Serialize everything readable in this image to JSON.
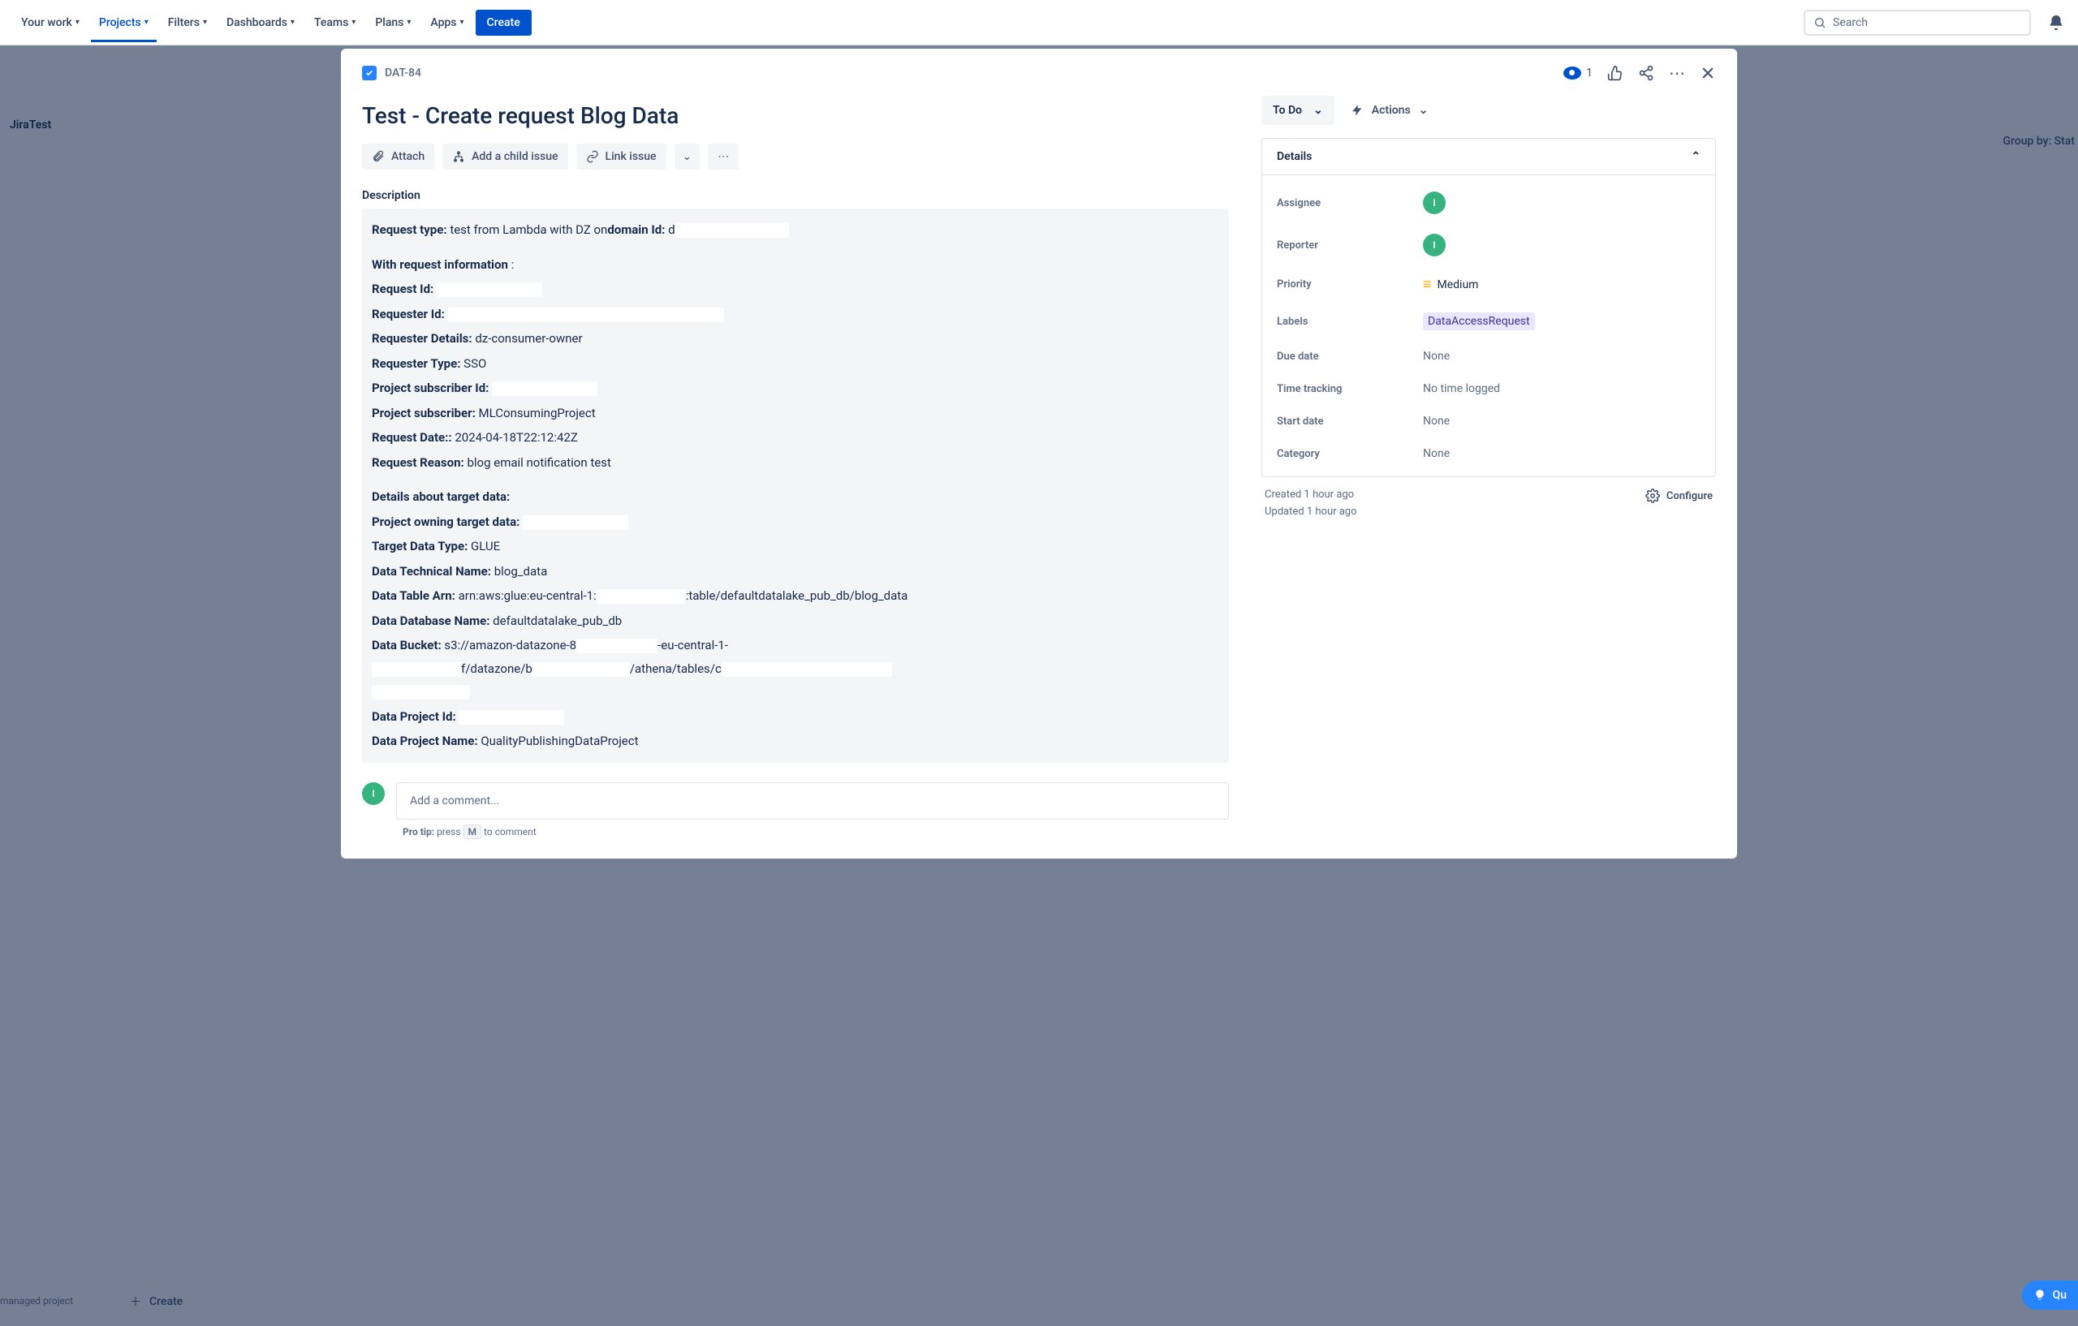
{
  "nav": {
    "your_work": "Your work",
    "projects": "Projects",
    "filters": "Filters",
    "dashboards": "Dashboards",
    "teams": "Teams",
    "plans": "Plans",
    "apps": "Apps",
    "create": "Create",
    "search_placeholder": "Search"
  },
  "board": {
    "left_title": "JiraTest",
    "group_by": "Group by: Stat",
    "managed": "managed project",
    "create_label": "Create",
    "quick": "Qu"
  },
  "issue": {
    "key": "DAT-84",
    "title": "Test - Create request Blog Data",
    "watch_count": "1",
    "actions": {
      "attach": "Attach",
      "add_child": "Add a child issue",
      "link": "Link issue"
    },
    "status": "To Do",
    "actions_label": "Actions",
    "description_label": "Description",
    "desc": {
      "request_type_label": "Request type:",
      "request_type_value": "test from Lambda with DZ on",
      "domain_id_label": "domain Id:",
      "domain_id_value": "d",
      "with_request_info": "With request information",
      "request_id_label": "Request Id:",
      "requester_id_label": "Requester Id:",
      "requester_details_label": "Requester Details:",
      "requester_details_value": "dz-consumer-owner",
      "requester_type_label": "Requester Type:",
      "requester_type_value": "SSO",
      "proj_sub_id_label": "Project subscriber Id:",
      "proj_sub_label": "Project subscriber:",
      "proj_sub_value": "MLConsumingProject",
      "request_date_label": "Request Date::",
      "request_date_value": "2024-04-18T22:12:42Z",
      "request_reason_label": "Request Reason:",
      "request_reason_value": "blog email notification test",
      "details_target_label": "Details about target data:",
      "proj_owning_label": "Project owning target data:",
      "target_type_label": "Target Data Type:",
      "target_type_value": "GLUE",
      "tech_name_label": "Data Technical Name:",
      "tech_name_value": "blog_data",
      "table_arn_label": "Data Table Arn:",
      "table_arn_value_a": "arn:aws:glue:eu-central-1:",
      "table_arn_value_b": ":table/defaultdatalake_pub_db/blog_data",
      "db_name_label": "Data Database Name:",
      "db_name_value": "defaultdatalake_pub_db",
      "bucket_label": "Data Bucket:",
      "bucket_value_a": "s3://amazon-datazone-8",
      "bucket_value_b": "-eu-central-1-",
      "bucket_value_c": "f/datazone/b",
      "bucket_value_d": "/athena/tables/c",
      "data_proj_id_label": "Data Project Id:",
      "data_proj_name_label": "Data Project Name:",
      "data_proj_name_value": "QualityPublishingDataProject"
    },
    "comment_placeholder": "Add a comment...",
    "protip_label": "Pro tip:",
    "protip_press": "press",
    "protip_key": "M",
    "protip_rest": "to comment"
  },
  "details": {
    "panel_title": "Details",
    "assignee_label": "Assignee",
    "reporter_label": "Reporter",
    "avatar_initial": "I",
    "priority_label": "Priority",
    "priority_value": "Medium",
    "labels_label": "Labels",
    "labels_value": "DataAccessRequest",
    "due_date_label": "Due date",
    "due_date_value": "None",
    "time_tracking_label": "Time tracking",
    "time_tracking_value": "No time logged",
    "start_date_label": "Start date",
    "start_date_value": "None",
    "category_label": "Category",
    "category_value": "None",
    "created": "Created 1 hour ago",
    "updated": "Updated 1 hour ago",
    "configure": "Configure"
  }
}
